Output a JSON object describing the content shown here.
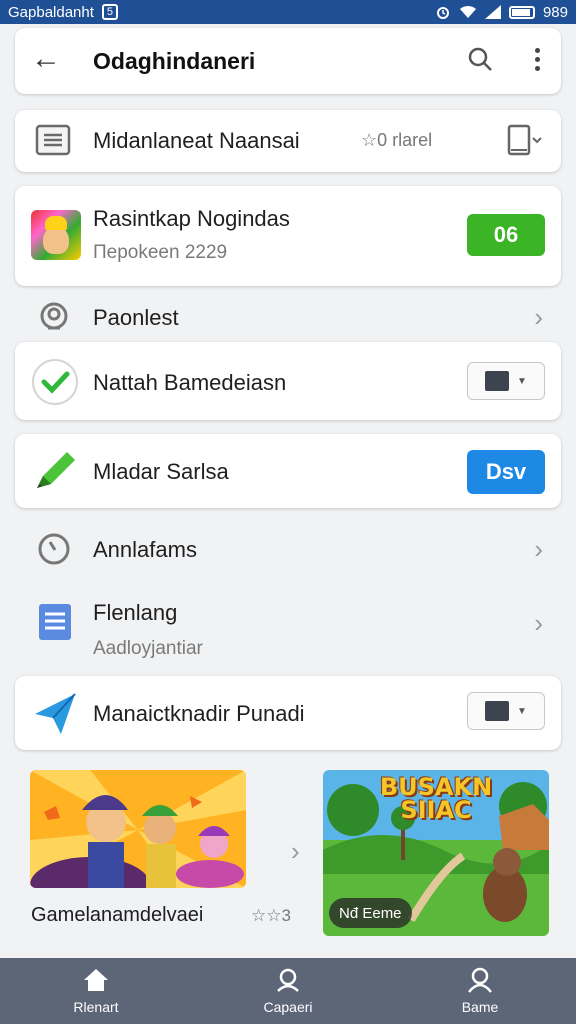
{
  "status_bar": {
    "carrier": "Gapbaldanht",
    "sim_label": "5",
    "time": "989"
  },
  "app_bar": {
    "title": "Odaghindaneri"
  },
  "row1": {
    "title": "Midanlaneat Naansai",
    "rating_text": "☆0 rlarel"
  },
  "row2": {
    "title": "Rasintkap Nogindas",
    "subtitle": "Пepokeen 2229",
    "button_label": "06"
  },
  "row3": {
    "title": "Paonlest"
  },
  "row4": {
    "title": "Nattah Bamedeiasn"
  },
  "row5": {
    "title": "Mladar Sarlsa",
    "button_label": "Dsv"
  },
  "row6": {
    "title": "Annlafams"
  },
  "row7": {
    "title": "Flenlang",
    "subtitle": "Aadloyjantiar"
  },
  "row8": {
    "title": "Manaictknadir Punadi"
  },
  "game_card": {
    "caption": "Gamelanamdelvaei",
    "rating_text": "☆☆3",
    "thumb2_title": "BUSAKN\nSIIAC",
    "thumb2_badge": "Nđ Eeme"
  },
  "bottom_nav": [
    {
      "label": "Rlenart",
      "icon": "home-icon"
    },
    {
      "label": "Capaeri",
      "icon": "location-icon"
    },
    {
      "label": "Bame",
      "icon": "profile-icon"
    }
  ],
  "colors": {
    "status_bar": "#1f4f95",
    "green_button": "#3bb425",
    "blue_button": "#1e88e5",
    "nav_bar": "#5c6676"
  }
}
